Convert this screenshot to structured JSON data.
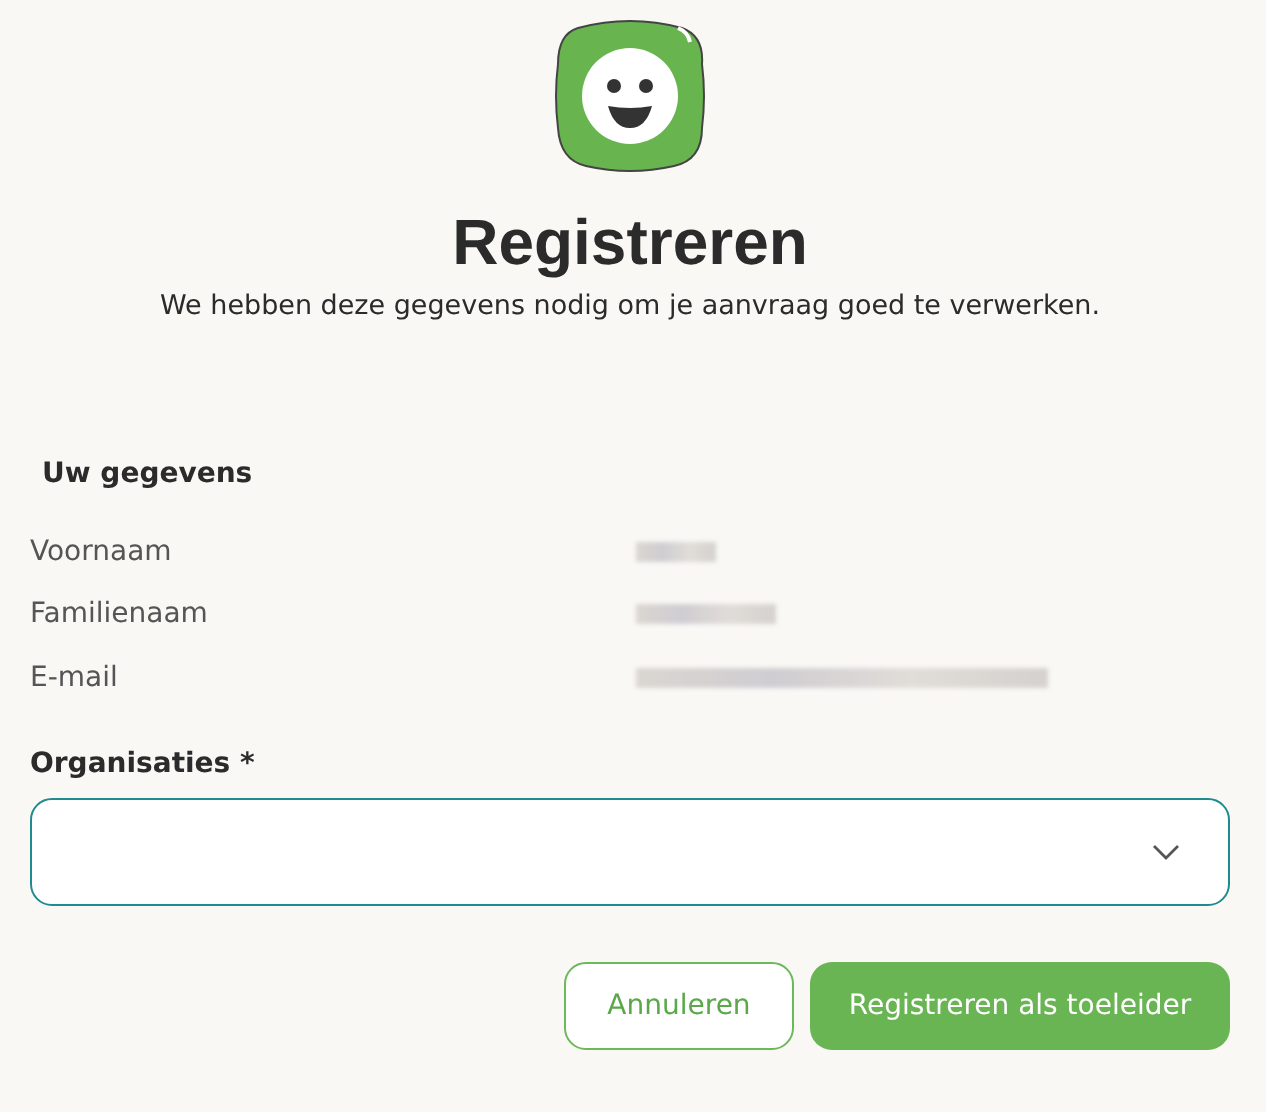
{
  "header": {
    "title": "Registreren",
    "subtitle": "We hebben deze gegevens nodig om je aanvraag goed te verwerken."
  },
  "details": {
    "heading": "Uw gegevens",
    "rows": [
      {
        "label": "Voornaam",
        "redacted": true
      },
      {
        "label": "Familienaam",
        "redacted": true
      },
      {
        "label": "E-mail",
        "redacted": true
      }
    ]
  },
  "organisations": {
    "label": "Organisaties *"
  },
  "buttons": [
    {
      "label": "Annuleren",
      "kind": "secondary"
    },
    {
      "label": "Registreren als toeleider",
      "kind": "primary"
    }
  ]
}
